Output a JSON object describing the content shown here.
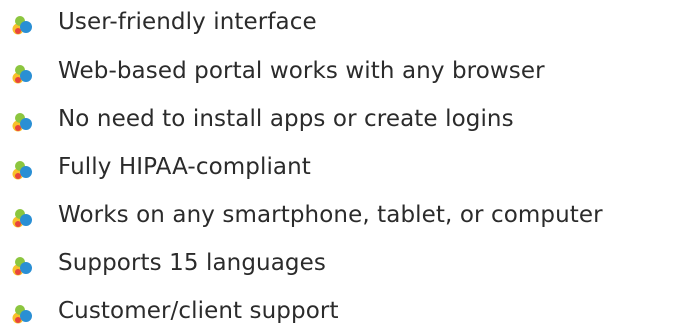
{
  "features": {
    "icon": "cloud-cluster-bullet-icon",
    "colors": {
      "text": "#2b2b2b",
      "icon_green": "#8cc63f",
      "icon_yellow": "#f7c12b",
      "icon_red": "#e8453c",
      "icon_blue": "#2a8fd4"
    },
    "items": [
      {
        "label": "User-friendly interface"
      },
      {
        "label": "Web-based portal works with any browser"
      },
      {
        "label": "No need to install apps or create logins"
      },
      {
        "label": "Fully HIPAA-compliant"
      },
      {
        "label": "Works on any smartphone, tablet, or computer"
      },
      {
        "label": "Supports 15 languages"
      },
      {
        "label": "Customer/client support"
      }
    ]
  }
}
